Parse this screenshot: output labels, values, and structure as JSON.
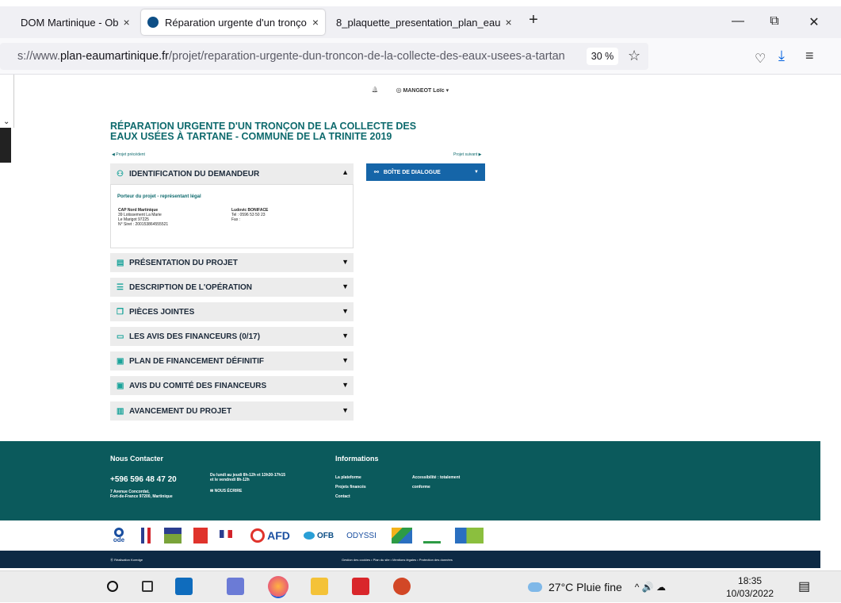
{
  "tabs": [
    {
      "label": "DOM Martinique - Ob",
      "close": "×"
    },
    {
      "label": "Réparation urgente d'un tronço",
      "close": "×"
    },
    {
      "label": "8_plaquette_presentation_plan_eau",
      "close": "×"
    }
  ],
  "browser": {
    "new_tab": "+",
    "minimize": "—",
    "restore": "⧉",
    "close": "✕",
    "url_prefix": "s://www.",
    "url_domain": "plan-eaumartinique.fr",
    "url_path": "/projet/reparation-urgente-dun-troncon-de-la-collecte-des-eaux-usees-a-tartan",
    "zoom": "30 %",
    "bookmark_icon": "☆",
    "pocket_icon": "♡",
    "download_icon": "⤓",
    "menu_icon": "≡"
  },
  "userbar": {
    "bell_icon": "🔔",
    "user_icon": "◎",
    "user_name": "MANGEOT Loïc",
    "caret": "▾"
  },
  "page": {
    "title_line1": "RÉPARATION URGENTE D'UN TRONÇON DE LA COLLECTE DES",
    "title_line2": "EAUX USÉES À TARTANE - COMMUNE DE LA TRINITE 2019",
    "prev_link": "◀  Projet précédent",
    "next_link": "Projet suivant  ▶"
  },
  "sections": [
    {
      "icon": "⚇",
      "label": "IDENTIFICATION DU DEMANDEUR",
      "arrow": "▲"
    },
    {
      "icon": "▤",
      "label": "PRÉSENTATION DU PROJET",
      "arrow": "▼"
    },
    {
      "icon": "☰",
      "label": "DESCRIPTION DE L'OPÉRATION",
      "arrow": "▼"
    },
    {
      "icon": "❐",
      "label": "PIÈCES JOINTES",
      "arrow": "▼"
    },
    {
      "icon": "▭",
      "label": "LES AVIS DES FINANCEURS (0/17)",
      "arrow": "▼"
    },
    {
      "icon": "▣",
      "label": "PLAN DE FINANCEMENT DÉFINITIF",
      "arrow": "▼"
    },
    {
      "icon": "▣",
      "label": "AVIS DU COMITÉ DES FINANCEURS",
      "arrow": "▼"
    },
    {
      "icon": "▥",
      "label": "AVANCEMENT DU PROJET",
      "arrow": "▼"
    }
  ],
  "identification": {
    "heading": "Porteur du projet - représentant légal",
    "org_name": "CAP Nord Martinique",
    "org_addr1": "39 Lotissement La Marie",
    "org_addr2": "Le Marigot 97225",
    "org_siret": "N° Siret : 200153864555521",
    "rep_name": "Ludovic BONIFACE",
    "rep_tel": "Tel : 0596 53 50 23",
    "rep_fax": "Fax :"
  },
  "dialog": {
    "icon": "⚯",
    "label": "BOÎTE DE DIALOGUE",
    "caret": "▼"
  },
  "footer": {
    "contact_title": "Nous Contacter",
    "phone": "+596 596 48 47 20",
    "address1": "7 Avenue Concordat,",
    "address2": "Fort-de-France 97200, Martinique",
    "hours1": "Du lundi au jeudi 8h-12h et 13h30-17h15",
    "hours2": "et le vendredi 8h-12h",
    "write_label": "✉ NOUS ÉCRIRE",
    "info_title": "Informations",
    "info_links": [
      "La plateforme",
      "Projets financés",
      "Contact"
    ],
    "accessibility": "Accessibilité : totalement",
    "accessibility2": "conforme"
  },
  "logos": [
    "ode",
    "",
    "",
    "",
    "",
    "AFD",
    "OFB",
    "ODYSSI",
    "",
    "",
    ""
  ],
  "legal": {
    "credit": "Ⓚ  Réalisation Koredge",
    "links": "Gestion des cookies  •  Plan du site  •  Mentions légales  •  Protection des données"
  },
  "taskbar": {
    "weather": "27°C  Pluie fine",
    "tray_icons": "^  🔊  ☁",
    "time": "18:35",
    "date": "10/03/2022",
    "notif_icon": "▤"
  }
}
